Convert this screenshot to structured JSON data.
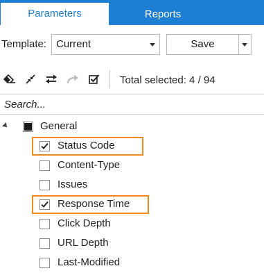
{
  "tabs": [
    {
      "label": "Parameters",
      "active": true
    },
    {
      "label": "Reports",
      "active": false
    }
  ],
  "template": {
    "label": "Template:",
    "selected": "Current",
    "save_label": "Save"
  },
  "toolbar": {
    "icons": [
      "eraser-icon",
      "collapse-arrows-icon",
      "swap-arrows-icon",
      "redo-arrow-icon",
      "checklist-icon"
    ],
    "total_selected": "Total selected: 4 / 94"
  },
  "search": {
    "placeholder": "Search..."
  },
  "tree": {
    "group": {
      "label": "General",
      "state": "partial"
    },
    "items": [
      {
        "label": "Status Code",
        "checked": true,
        "highlighted": true
      },
      {
        "label": "Content-Type",
        "checked": false,
        "highlighted": false
      },
      {
        "label": "Issues",
        "checked": false,
        "highlighted": false
      },
      {
        "label": "Response Time",
        "checked": true,
        "highlighted": true
      },
      {
        "label": "Click Depth",
        "checked": false,
        "highlighted": false
      },
      {
        "label": "URL Depth",
        "checked": false,
        "highlighted": false
      },
      {
        "label": "Last-Modified",
        "checked": false,
        "highlighted": false
      }
    ]
  },
  "colors": {
    "accent": "#1d7fd4",
    "highlight": "#ef8a1a"
  }
}
